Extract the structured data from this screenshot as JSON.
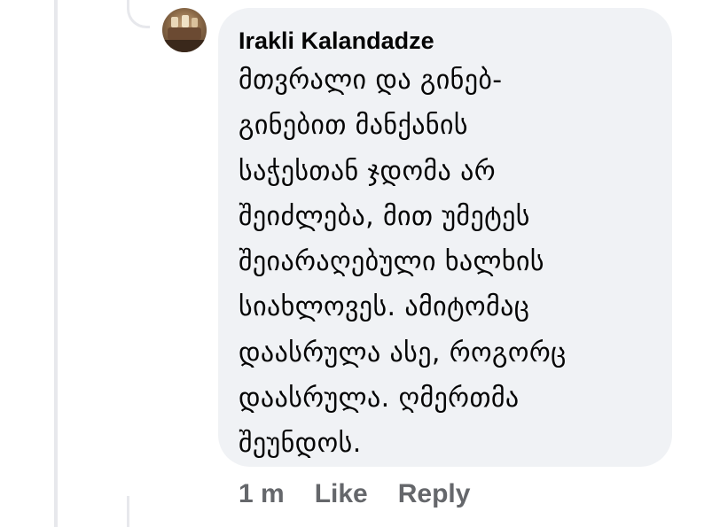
{
  "comment": {
    "author": "Irakli Kalandadze",
    "text_lines": [
      "მთვრალი და გინებ-",
      "გინებით მანქანის",
      "საჭესთან ჯდომა არ",
      "შეიძლება, მით უმეტეს",
      "შეიარაღებული ხალხის",
      "სიახლოვეს. ამიტომაც",
      "დაასრულა ასე, როგორც",
      "დაასრულა. ღმერთმა",
      "შეუნდოს."
    ],
    "avatar_icon": "user-avatar-photo",
    "bubble_color": "#f0f2f5"
  },
  "actions": {
    "timestamp": "1 m",
    "like_label": "Like",
    "reply_label": "Reply",
    "text_color": "#65676b"
  }
}
